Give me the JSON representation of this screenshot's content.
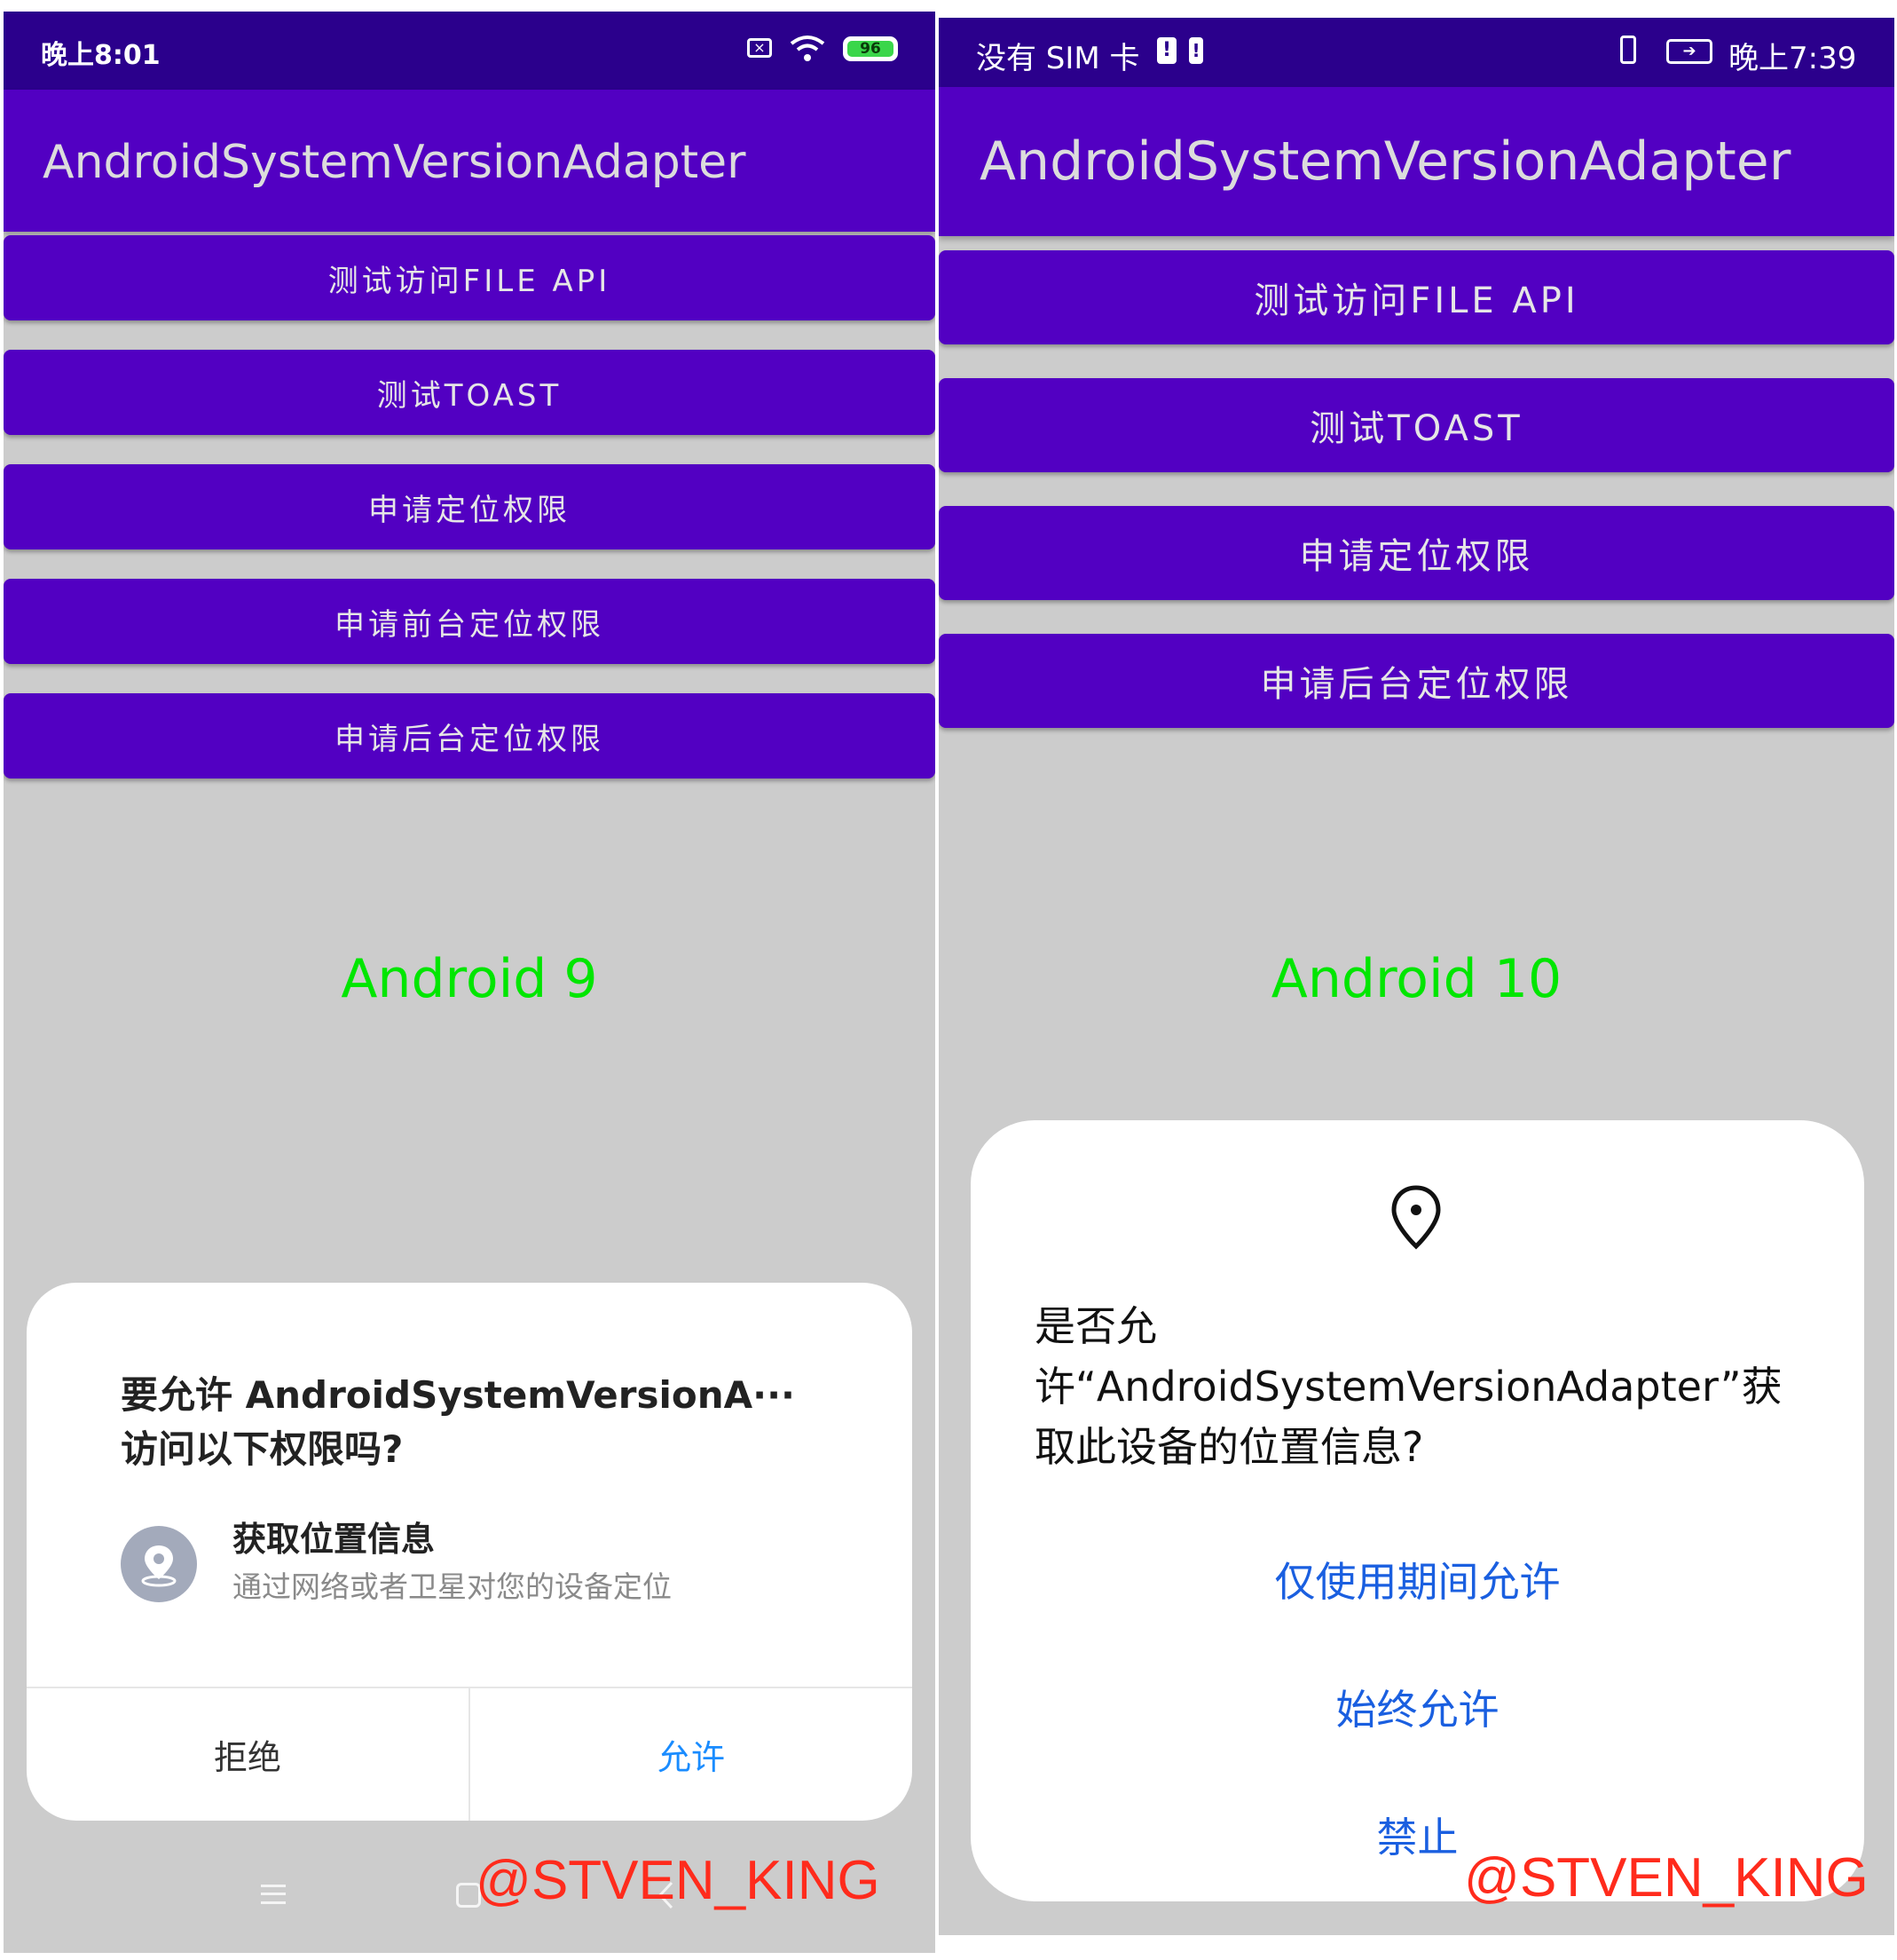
{
  "left": {
    "status": {
      "time": "晚上8:01",
      "battery": "96"
    },
    "app_title": "AndroidSystemVersionAdapter",
    "buttons": [
      "测试访问FILE API",
      "测试TOAST",
      "申请定位权限",
      "申请前台定位权限",
      "申请后台定位权限"
    ],
    "version_label": "Android 9",
    "dialog": {
      "question": "要允许 AndroidSystemVersionA··· 访问以下权限吗?",
      "permission_title": "获取位置信息",
      "permission_desc": "通过网络或者卫星对您的设备定位",
      "deny_label": "拒绝",
      "allow_label": "允许"
    },
    "watermark": "@STVEN_KING"
  },
  "right": {
    "status": {
      "carrier": "没有 SIM 卡",
      "time": "晚上7:39"
    },
    "app_title": "AndroidSystemVersionAdapter",
    "buttons": [
      "测试访问FILE API",
      "测试TOAST",
      "申请定位权限",
      "申请后台定位权限"
    ],
    "version_label": "Android 10",
    "dialog": {
      "question_line1": "是否允",
      "question_line2": "许“AndroidSystemVersionAdapter”获",
      "question_line3": "取此设备的位置信息?",
      "option_while_using": "仅使用期间允许",
      "option_always": "始终允许",
      "option_deny": "禁止"
    },
    "watermark": "@STVEN_KING"
  },
  "colors": {
    "status_bar": "#2b008c",
    "app_bar": "#5200c2",
    "button": "#5200c2",
    "background": "#cccccc",
    "version_label": "#00e600",
    "dialog_accent_left": "#1a8cff",
    "dialog_accent_right": "#1a5fe0",
    "watermark": "#ff2b1c"
  }
}
